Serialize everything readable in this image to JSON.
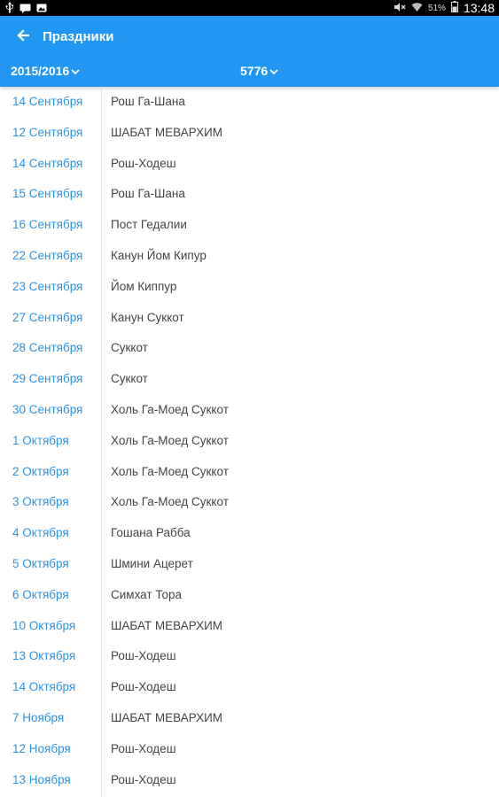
{
  "status_bar": {
    "battery_percent": "51%",
    "time": "13:48"
  },
  "app_bar": {
    "title": "Праздники",
    "back_icon": "arrow-left-icon",
    "year_selector": "2015/2016",
    "hebrew_year_selector": "5776",
    "color": "#2196f3"
  },
  "holidays": [
    {
      "date": "14 Сентября",
      "name": "Рош Га-Шана"
    },
    {
      "date": "12 Сентября",
      "name": "ШАБАТ МЕВАРХИМ"
    },
    {
      "date": "14 Сентября",
      "name": "Рош-Ходеш"
    },
    {
      "date": "15 Сентября",
      "name": "Рош Га-Шана"
    },
    {
      "date": "16 Сентября",
      "name": "Пост Гедалии"
    },
    {
      "date": "22 Сентября",
      "name": "Канун Йом Кипур"
    },
    {
      "date": "23 Сентября",
      "name": "Йом Киппур"
    },
    {
      "date": "27 Сентября",
      "name": "Канун Суккот"
    },
    {
      "date": "28 Сентября",
      "name": "Суккот"
    },
    {
      "date": "29 Сентября",
      "name": "Суккот"
    },
    {
      "date": "30 Сентября",
      "name": "Холь Га-Моед Суккот"
    },
    {
      "date": "1 Октября",
      "name": "Холь Га-Моед Суккот"
    },
    {
      "date": "2 Октября",
      "name": "Холь Га-Моед Суккот"
    },
    {
      "date": "3 Октября",
      "name": "Холь Га-Моед Суккот"
    },
    {
      "date": "4 Октября",
      "name": "Гошана Рабба"
    },
    {
      "date": "5 Октября",
      "name": "Шмини Ацерет"
    },
    {
      "date": "6 Октября",
      "name": "Симхат Тора"
    },
    {
      "date": "10 Октября",
      "name": "ШАБАТ МЕВАРХИМ"
    },
    {
      "date": "13 Октября",
      "name": "Рош-Ходеш"
    },
    {
      "date": "14 Октября",
      "name": "Рош-Ходеш"
    },
    {
      "date": "7 Ноября",
      "name": "ШАБАТ МЕВАРХИМ"
    },
    {
      "date": "12 Ноября",
      "name": "Рош-Ходеш"
    },
    {
      "date": "13 Ноября",
      "name": "Рош-Ходеш"
    }
  ]
}
